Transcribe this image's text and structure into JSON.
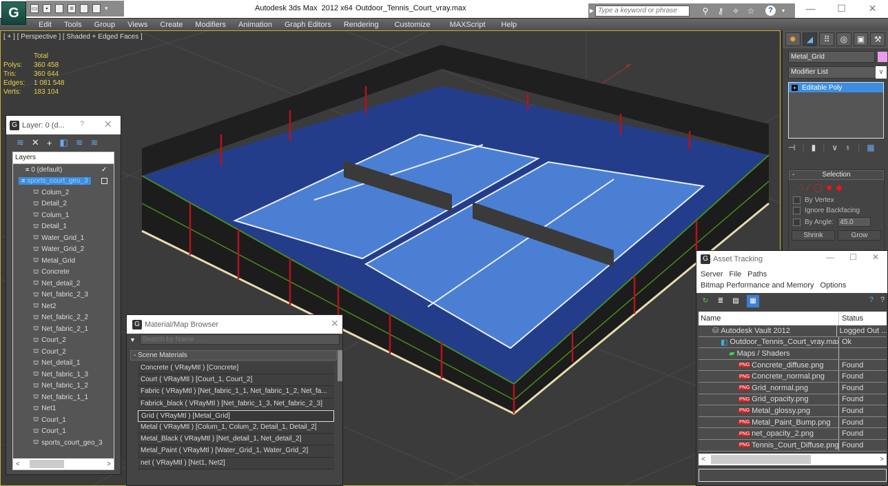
{
  "app": {
    "title": "Autodesk 3ds Max  2012 x64",
    "file": "Outdoor_Tennis_Court_vray.max",
    "logo_glyph": "G"
  },
  "quick_access": {
    "icons": [
      "open-icon",
      "save-icon",
      "new-icon",
      "copy-icon",
      "undo-icon",
      "redo-icon"
    ],
    "dropdown": "▾"
  },
  "infocenter": {
    "search_placeholder": "Type a keyword or phrase",
    "icons": [
      "binoculars-icon",
      "key-icon",
      "satellite-icon",
      "star-icon",
      "help-icon"
    ]
  },
  "window_controls": {
    "minimize": "—",
    "maximize": "☐",
    "close": "✕"
  },
  "menu": [
    "Edit",
    "Tools",
    "Group",
    "Views",
    "Create",
    "Modifiers",
    "Animation",
    "Graph Editors",
    "Rendering",
    "Customize",
    "MAXScript",
    "Help"
  ],
  "viewport": {
    "label": "[ + ] [ Perspective ] [ Shaded + Edged Faces ]",
    "stats": {
      "header": "Total",
      "rows": [
        {
          "k": "Polys:",
          "v": "360 458"
        },
        {
          "k": "Tris:",
          "v": "360 644"
        },
        {
          "k": "Edges:",
          "v": "1 081 548"
        },
        {
          "k": "Verts:",
          "v": "183 104"
        }
      ]
    },
    "colors": {
      "court_inner": "#4b7fd4",
      "court_outer": "#243d8a",
      "wall": "#1e1e1e",
      "post": "#b5121b",
      "rail": "#4a8a1a",
      "base": "#e7dcae"
    }
  },
  "command_panel": {
    "tabs": [
      "create-tab",
      "modify-tab",
      "hierarchy-tab",
      "motion-tab",
      "display-tab",
      "utilities-tab"
    ],
    "object_name": "Metal_Grid",
    "object_color": "#e69ee8",
    "modifier_list": "Modifier List",
    "stack_item": "Editable Poly",
    "selection_rollout": {
      "title": "Selection",
      "by_vertex": "By Vertex",
      "ignore_backfacing": "Ignore Backfacing",
      "by_angle": "By Angle:",
      "angle_value": "45.0",
      "shrink": "Shrink",
      "grow": "Grow"
    }
  },
  "layer_dialog": {
    "title": "Layer: 0 (d...",
    "help": "?",
    "close": "✕",
    "column": "Layers",
    "default_layer": "0 (default)",
    "selected_layer": "sports_court_geo_3",
    "objects": [
      "Colum_2",
      "Detail_2",
      "Colum_1",
      "Detail_1",
      "Water_Grid_1",
      "Water_Grid_2",
      "Metal_Grid",
      "Concrete",
      "Net_detail_2",
      "Net_fabric_2_3",
      "Net2",
      "Net_fabric_2_2",
      "Net_fabric_2_1",
      "Court_2",
      "Court_2",
      "Net_detail_1",
      "Net_fabric_1_3",
      "Net_fabric_1_2",
      "Net_fabric_1_1",
      "Net1",
      "Court_1",
      "Court_1",
      "sports_court_geo_3"
    ]
  },
  "material_browser": {
    "title": "Material/Map Browser",
    "close": "✕",
    "search_placeholder": "Search by Name ...",
    "group": "- Scene Materials",
    "materials": [
      "Concrete  ( VRayMtl ) [Concrete]",
      "Court  ( VRayMtl ) [Court_1, Court_2]",
      "Fabric  ( VRayMtl ) [Net_fabric_1_1, Net_fabric_1_2, Net_fa...",
      "Fabrick_black  ( VRayMtl ) [Net_fabric_1_3, Net_fabric_2_3]",
      "Grid  ( VRayMtl ) [Metal_Grid]",
      "Metal  ( VRayMtl ) [Colum_1, Colum_2, Detail_1, Detail_2]",
      "Metal_Black  ( VRayMtl ) [Net_detail_1, Net_detail_2]",
      "Metal_Paint  ( VRayMtl ) [Water_Grid_1, Water_Grid_2]",
      "net  ( VRayMtl ) [Net1, Net2]"
    ],
    "selected_index": 4
  },
  "asset_tracking": {
    "title": "Asset Tracking",
    "menu_row1": [
      "Server",
      "File",
      "Paths"
    ],
    "menu_row2": [
      "Bitmap Performance and Memory",
      "Options"
    ],
    "columns": {
      "name": "Name",
      "status": "Status"
    },
    "rows": [
      {
        "name": "Autodesk Vault 2012",
        "status": "Logged Out ...",
        "level": 1,
        "icon": "vault-icon"
      },
      {
        "name": "Outdoor_Tennis_Court_vray.max",
        "status": "Ok",
        "level": 2,
        "icon": "max-file-icon"
      },
      {
        "name": "Maps / Shaders",
        "status": "",
        "level": 3,
        "icon": "maps-folder-icon"
      },
      {
        "name": "Concrete_diffuse.png",
        "status": "Found",
        "level": 4,
        "icon": "png-icon"
      },
      {
        "name": "Concrete_normal.png",
        "status": "Found",
        "level": 4,
        "icon": "png-icon"
      },
      {
        "name": "Grid_normal.png",
        "status": "Found",
        "level": 4,
        "icon": "png-icon"
      },
      {
        "name": "Grid_opacity.png",
        "status": "Found",
        "level": 4,
        "icon": "png-icon"
      },
      {
        "name": "Metal_glossy.png",
        "status": "Found",
        "level": 4,
        "icon": "png-icon"
      },
      {
        "name": "Metal_Paint_Bump.png",
        "status": "Found",
        "level": 4,
        "icon": "png-icon"
      },
      {
        "name": "net_opacity_2.png",
        "status": "Found",
        "level": 4,
        "icon": "png-icon"
      },
      {
        "name": "Tennis_Court_Diffuse.png",
        "status": "Found",
        "level": 4,
        "icon": "png-icon"
      }
    ]
  }
}
